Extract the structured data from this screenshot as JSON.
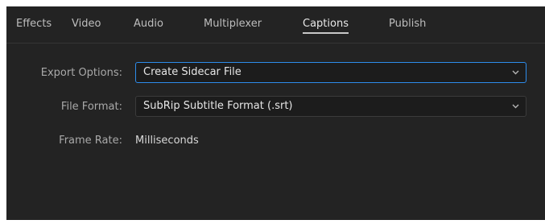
{
  "tabs": [
    {
      "label": "Effects"
    },
    {
      "label": "Video"
    },
    {
      "label": "Audio"
    },
    {
      "label": "Multiplexer"
    },
    {
      "label": "Captions",
      "active": true
    },
    {
      "label": "Publish"
    }
  ],
  "form": {
    "export_options": {
      "label": "Export Options:",
      "value": "Create Sidecar File",
      "icon": "chevron-down-icon"
    },
    "file_format": {
      "label": "File Format:",
      "value": "SubRip Subtitle Format (.srt)",
      "icon": "chevron-down-icon"
    },
    "frame_rate": {
      "label": "Frame Rate:",
      "value": "Milliseconds"
    }
  },
  "colors": {
    "panel_background": "#232323",
    "focus_accent": "#2d8ceb",
    "active_tab_underline": "#c8c8c8"
  }
}
